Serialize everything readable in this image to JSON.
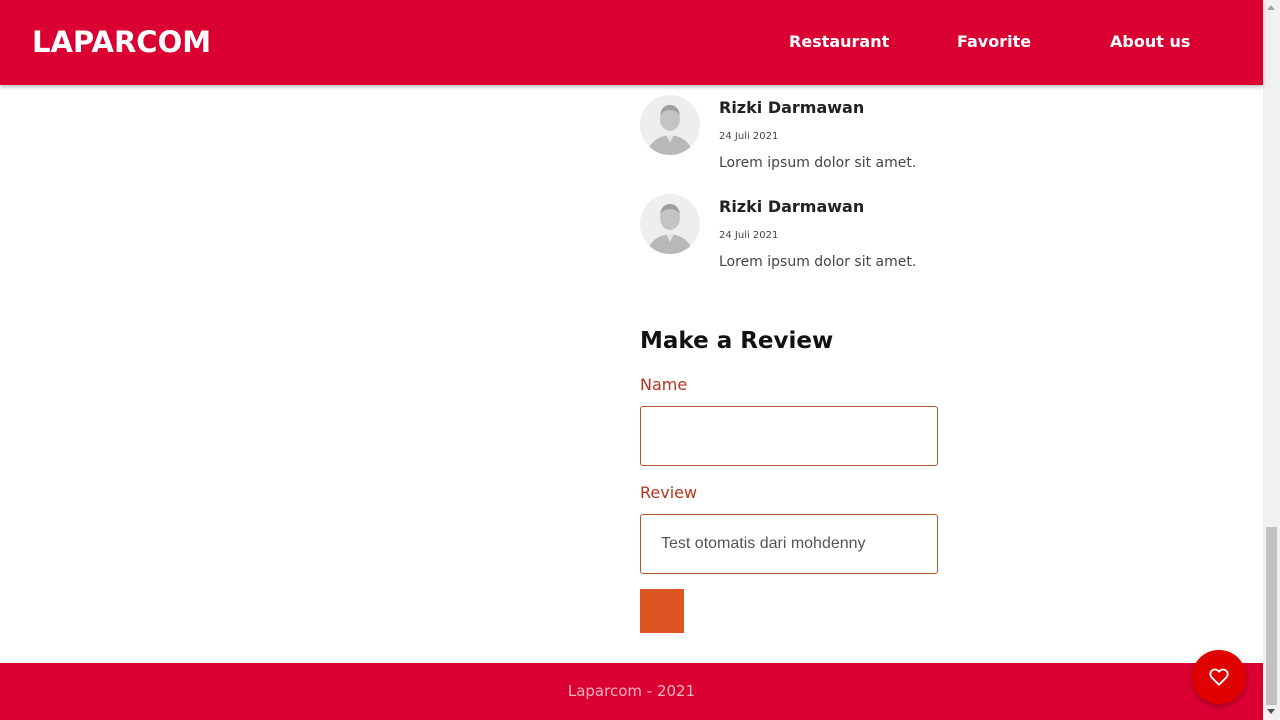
{
  "header": {
    "brand": "LAPARCOM",
    "nav": [
      {
        "label": "Restaurant"
      },
      {
        "label": "Favorite"
      },
      {
        "label": "About us"
      }
    ]
  },
  "reviews": [
    {
      "name": "Rizki Darmawan",
      "date": "24 Juli 2021",
      "text": "Lorem ipsum dolor sit amet."
    },
    {
      "name": "Rizki Darmawan",
      "date": "24 Juli 2021",
      "text": "Lorem ipsum dolor sit amet."
    }
  ],
  "form": {
    "title": "Make a Review",
    "name_label": "Name",
    "name_value": "",
    "review_label": "Review",
    "review_value": "Test otomatis dari mohdenny"
  },
  "footer": {
    "text": "Laparcom - 2021"
  },
  "colors": {
    "primary": "#db0032",
    "accent": "#db5421",
    "label": "#b5341e",
    "fab": "#e00000"
  },
  "icons": {
    "fab": "heart-icon",
    "avatar": "user-avatar-icon"
  }
}
